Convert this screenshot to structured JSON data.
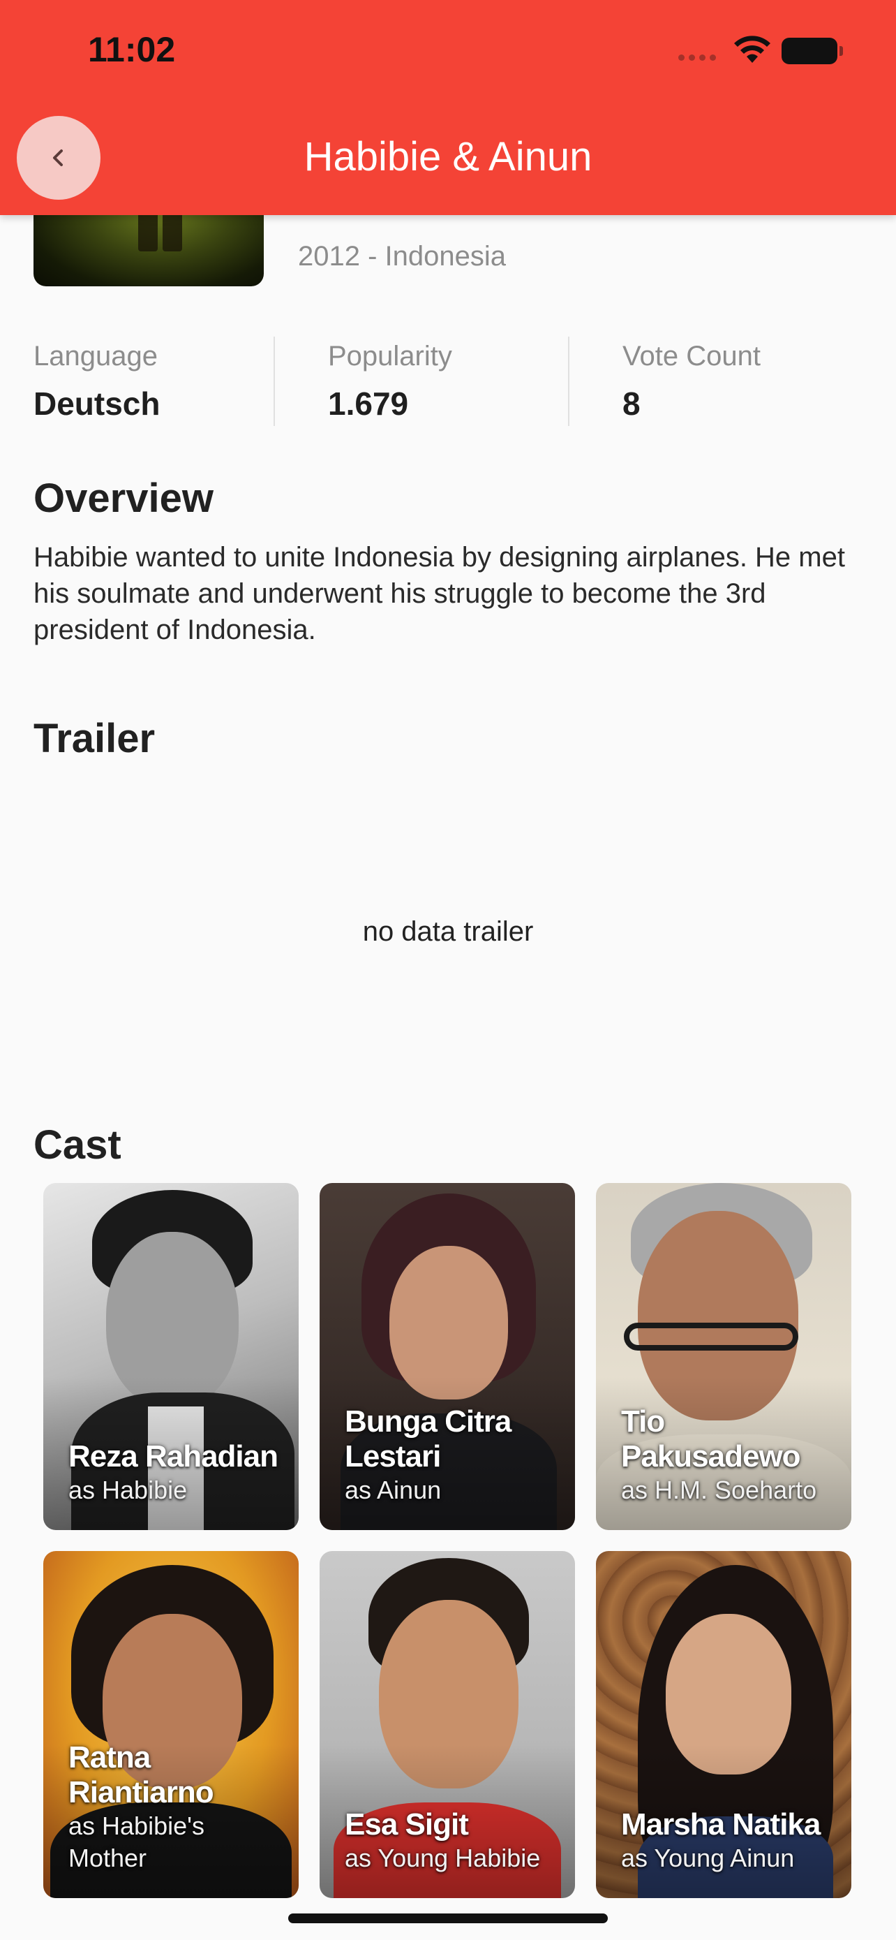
{
  "status_bar": {
    "time": "11:02"
  },
  "app_bar": {
    "title": "Habibie & Ainun"
  },
  "movie": {
    "year_country": "2012 - Indonesia"
  },
  "stats": [
    {
      "label": "Language",
      "value": "Deutsch"
    },
    {
      "label": "Popularity",
      "value": "1.679"
    },
    {
      "label": "Vote Count",
      "value": "8"
    }
  ],
  "overview": {
    "title": "Overview",
    "text": "Habibie wanted to unite Indonesia by designing airplanes. He met his soulmate and underwent his struggle to become the 3rd president of Indonesia."
  },
  "trailer": {
    "title": "Trailer",
    "empty_text": "no data trailer"
  },
  "cast": {
    "title": "Cast",
    "members": [
      {
        "name": "Reza Rahadian",
        "role": "as Habibie"
      },
      {
        "name": "Bunga Citra Lestari",
        "role": "as Ainun"
      },
      {
        "name": "Tio Pakusadewo",
        "role": "as H.M. Soeharto"
      },
      {
        "name": "Ratna Riantiarno",
        "role": "as Habibie's Mother"
      },
      {
        "name": "Esa Sigit",
        "role": "as Young Habibie"
      },
      {
        "name": "Marsha Natika",
        "role": "as Young Ainun"
      }
    ]
  },
  "colors": {
    "app_bar": "#f44336",
    "background": "#fafafa"
  },
  "icons": {
    "back": "chevron-left-icon",
    "wifi": "wifi-icon",
    "battery": "battery-icon"
  }
}
